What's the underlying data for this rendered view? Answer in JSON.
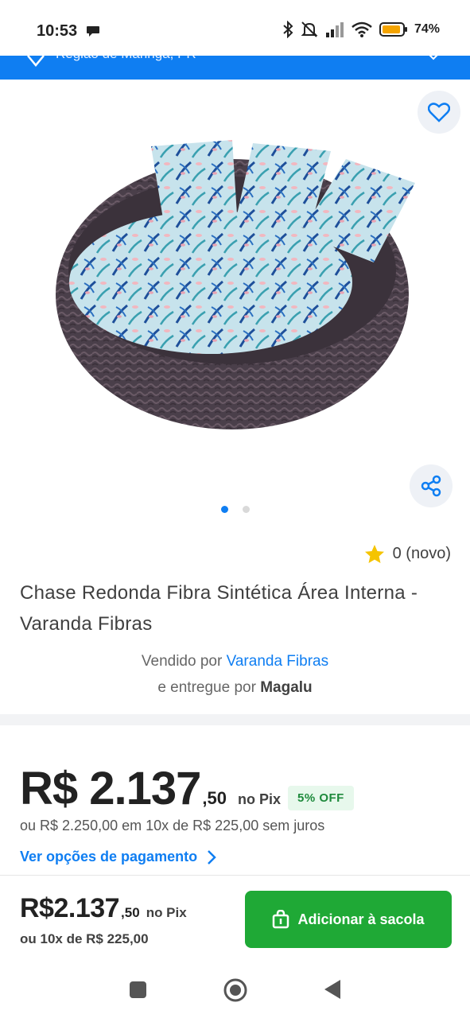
{
  "status_bar": {
    "time": "10:53",
    "battery_percent": "74%"
  },
  "location_bar": {
    "text": "Região de Maringá, PR",
    "color": "#0f7ef2"
  },
  "gallery": {
    "image_icon": "round-wicker-daybed-image",
    "favorite_icon": "heart-outline-icon",
    "share_icon": "share-icon",
    "page_count": 2,
    "active_page": 1
  },
  "rating": {
    "icon": "star-icon",
    "text": "0 (novo)"
  },
  "product": {
    "title": "Chase Redonda Fibra Sintética Área Interna - Varanda Fibras",
    "sold_by_label": "Vendido por",
    "seller_name": "Varanda Fibras",
    "delivered_by_label": "e entregue por",
    "delivered_by_name": "Magalu"
  },
  "pricing": {
    "price_main": "R$ 2.137",
    "price_cents": ",50",
    "pix_label": "no Pix",
    "discount_badge": "5% OFF",
    "installments_text": "ou R$ 2.250,00 em 10x de R$ 225,00 sem juros",
    "payment_options_link": "Ver opções de pagamento"
  },
  "bottom_bar": {
    "price_main": "R$2.137",
    "price_cents": ",50",
    "pix_label": "no Pix",
    "installments_text": "ou 10x de R$ 225,00",
    "add_button_label": "Adicionar à sacola",
    "add_button_color": "#1fa936"
  }
}
